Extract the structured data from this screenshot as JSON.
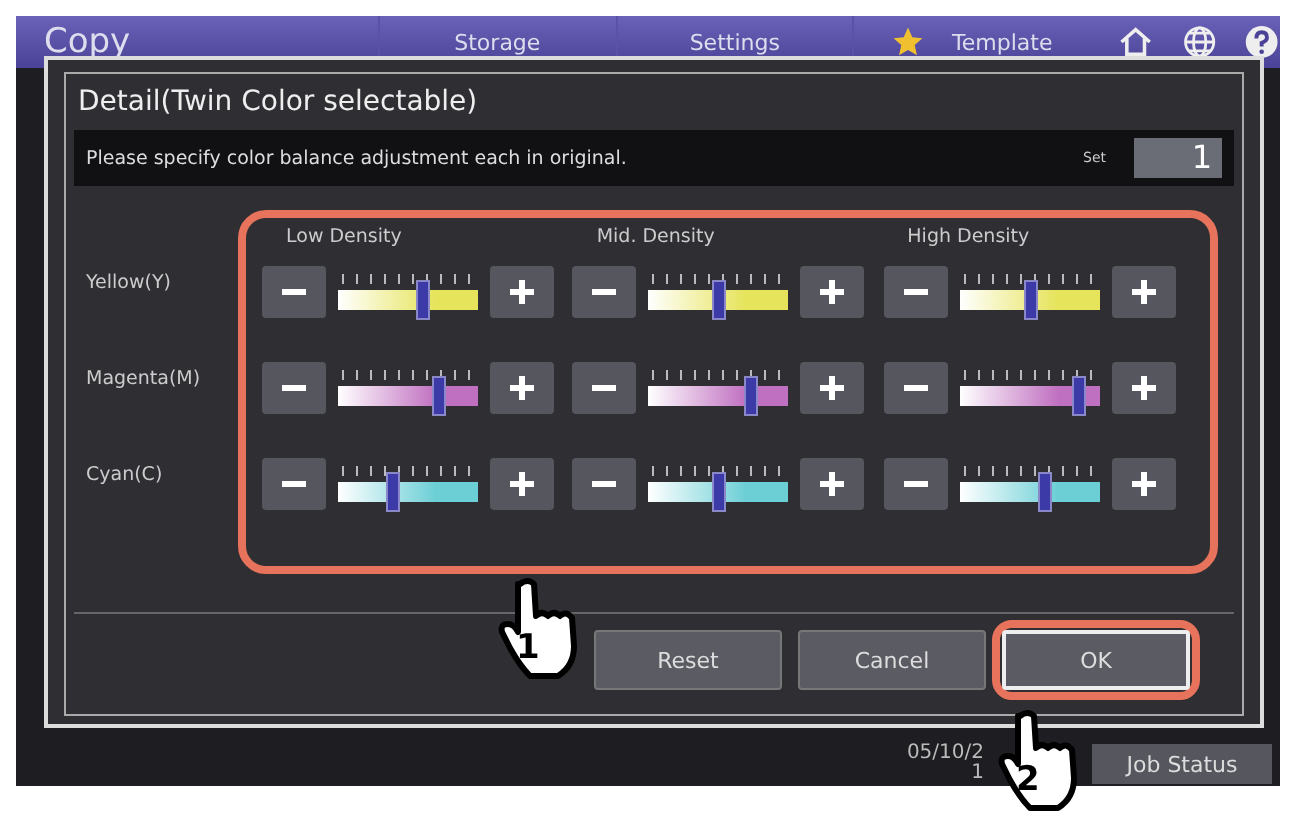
{
  "app": {
    "title": "Copy",
    "tabs": [
      {
        "label": "Storage",
        "kind": "plain"
      },
      {
        "label": "Settings",
        "kind": "plain"
      },
      {
        "label": "Template",
        "kind": "starred"
      }
    ]
  },
  "dialog": {
    "title": "Detail(Twin Color selectable)",
    "message": "Please specify color balance adjustment each in original.",
    "set_label": "Set",
    "set_value": "1",
    "panel_highlighted": true,
    "columns": [
      "Low Density",
      "Mid. Density",
      "High Density"
    ],
    "rows": [
      {
        "label": "Yellow(Y)",
        "color": "#e6e45a",
        "sliders": [
          {
            "level": 0.6
          },
          {
            "level": 0.5
          },
          {
            "level": 0.5
          }
        ]
      },
      {
        "label": "Magenta(M)",
        "color": "#c070c0",
        "sliders": [
          {
            "level": 0.72
          },
          {
            "level": 0.72
          },
          {
            "level": 0.85
          }
        ]
      },
      {
        "label": "Cyan(C)",
        "color": "#6ccfd6",
        "sliders": [
          {
            "level": 0.38
          },
          {
            "level": 0.5
          },
          {
            "level": 0.6
          }
        ]
      }
    ],
    "buttons": [
      {
        "label": "Reset",
        "highlighted": false
      },
      {
        "label": "Cancel",
        "highlighted": false
      },
      {
        "label": "OK",
        "highlighted": true
      }
    ]
  },
  "status_bar": {
    "date": "05/10/2",
    "time": "1",
    "button": "Job Status"
  },
  "callouts": [
    {
      "number": "1"
    },
    {
      "number": "2"
    }
  ]
}
